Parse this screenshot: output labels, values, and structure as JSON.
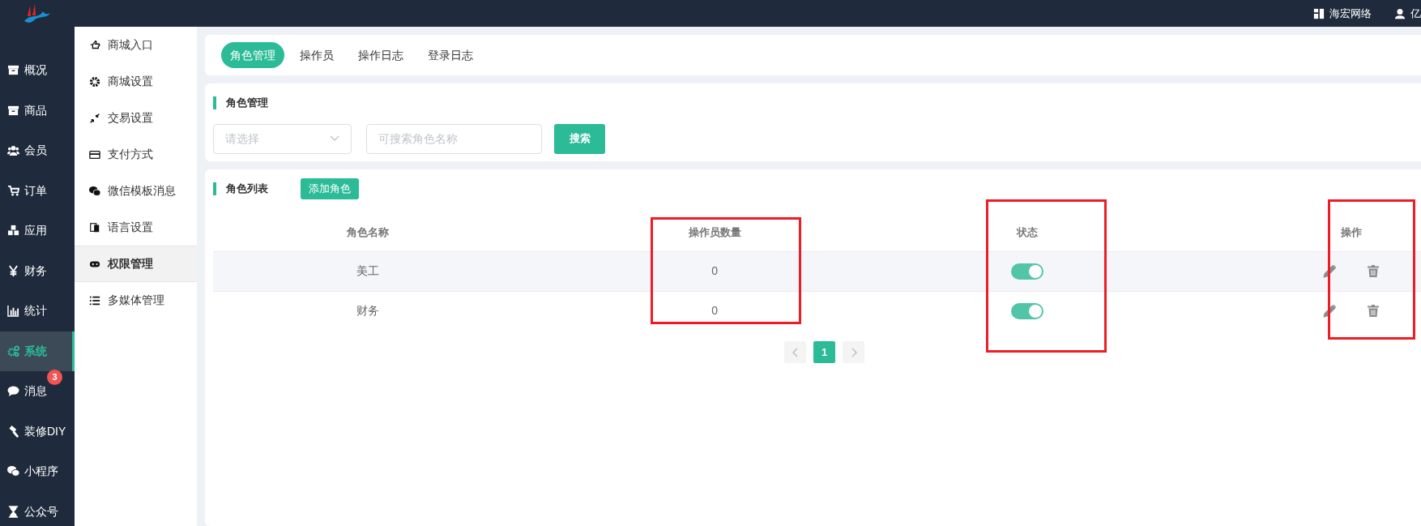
{
  "topbar": {
    "items": [
      {
        "kind": "shop",
        "label": "海宏网络"
      },
      {
        "kind": "user",
        "label": "亿"
      }
    ]
  },
  "main_menu": [
    {
      "label": "概况",
      "selected": false
    },
    {
      "label": "商品",
      "selected": false
    },
    {
      "label": "会员",
      "selected": false
    },
    {
      "label": "订单",
      "selected": false
    },
    {
      "label": "应用",
      "selected": false
    },
    {
      "label": "财务",
      "selected": false
    },
    {
      "label": "统计",
      "selected": false
    },
    {
      "label": "系统",
      "selected": true
    },
    {
      "label": "消息",
      "selected": false,
      "badge": "3"
    },
    {
      "label": "装修DIY",
      "selected": false
    },
    {
      "label": "小程序",
      "selected": false
    },
    {
      "label": "公众号",
      "selected": false
    }
  ],
  "sub_menu": [
    {
      "label": "商城入口",
      "selected": false
    },
    {
      "label": "商城设置",
      "selected": false
    },
    {
      "label": "交易设置",
      "selected": false
    },
    {
      "label": "支付方式",
      "selected": false
    },
    {
      "label": "微信模板消息",
      "selected": false
    },
    {
      "label": "语言设置",
      "selected": false
    },
    {
      "label": "权限管理",
      "selected": true
    },
    {
      "label": "多媒体管理",
      "selected": false
    }
  ],
  "tabs": [
    {
      "label": "角色管理",
      "selected": true
    },
    {
      "label": "操作员",
      "selected": false
    },
    {
      "label": "操作日志",
      "selected": false
    },
    {
      "label": "登录日志",
      "selected": false
    }
  ],
  "filter": {
    "title": "角色管理",
    "select": {
      "placeholder": "请选择"
    },
    "search": {
      "placeholder": "可搜索角色名称"
    },
    "button": "搜索"
  },
  "list": {
    "title": "角色列表",
    "add_button": "添加角色",
    "table": {
      "columns": [
        "角色名称",
        "操作员数量",
        "状态",
        "操作"
      ],
      "rows": [
        {
          "name": "美工",
          "count": "0",
          "on": true
        },
        {
          "name": "财务",
          "count": "0",
          "on": true
        }
      ]
    },
    "pagination": {
      "pages": [
        {
          "label": "1",
          "selected": true
        }
      ]
    }
  }
}
